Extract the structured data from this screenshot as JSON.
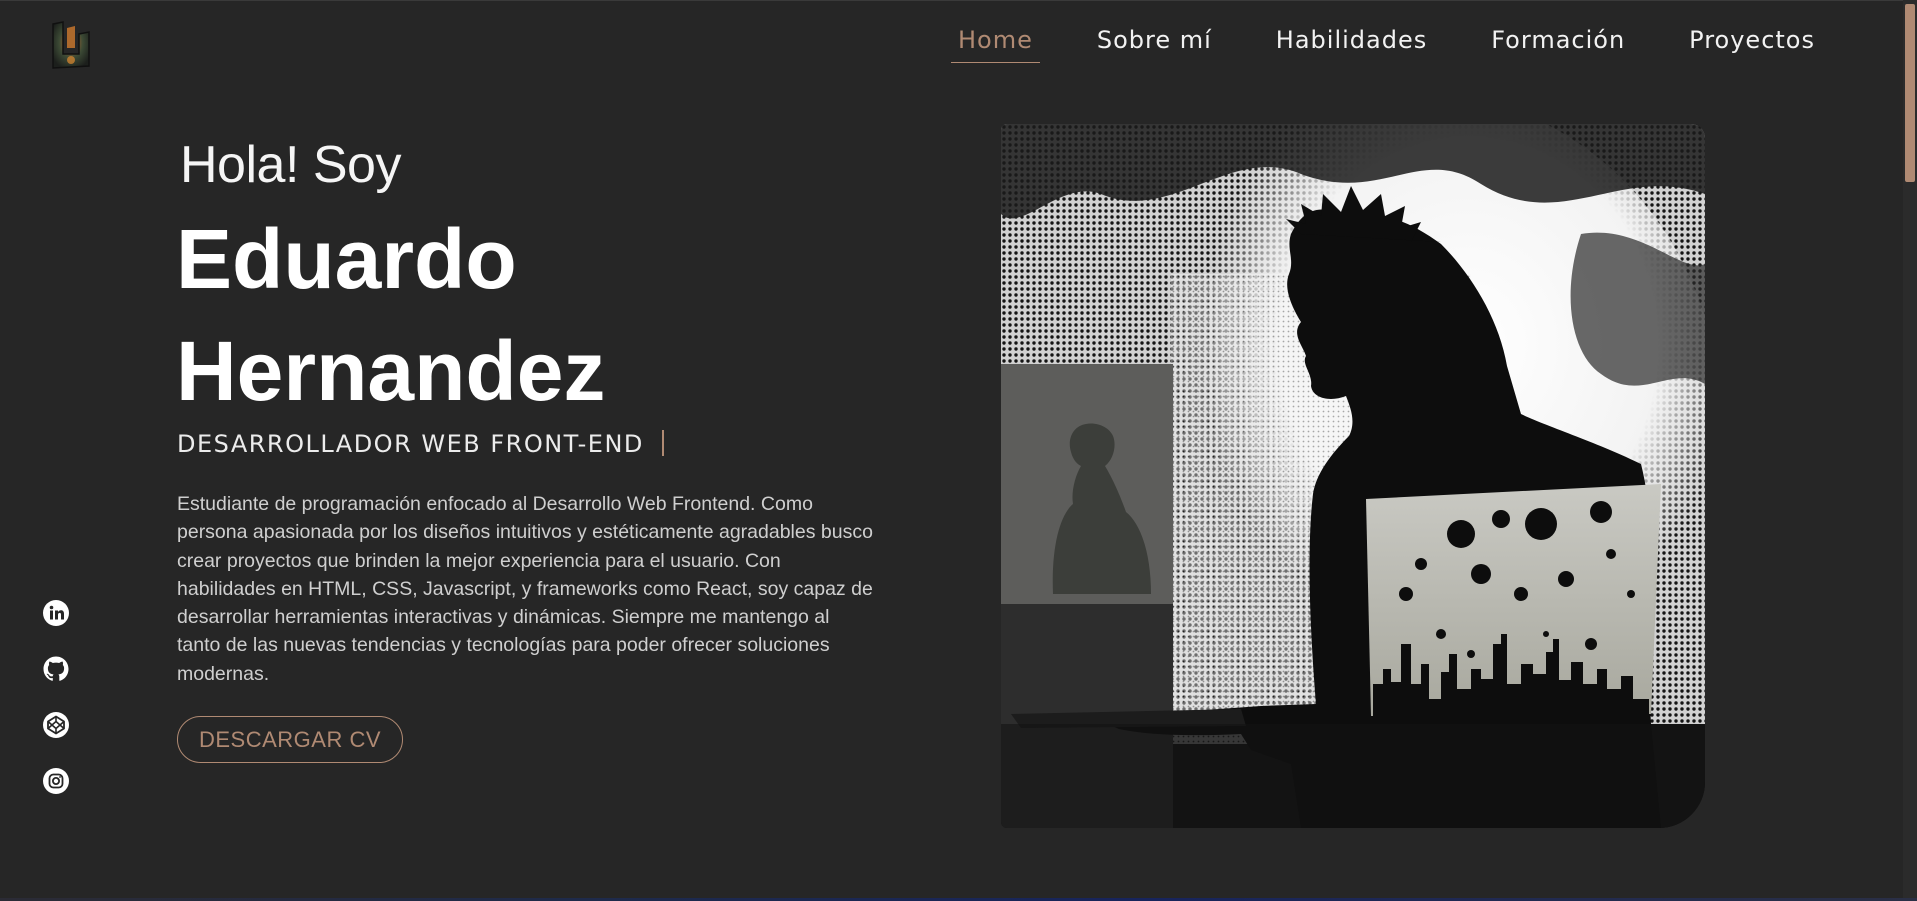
{
  "nav": {
    "items": [
      {
        "label": "Home",
        "active": true
      },
      {
        "label": "Sobre mí",
        "active": false
      },
      {
        "label": "Habilidades",
        "active": false
      },
      {
        "label": "Formación",
        "active": false
      },
      {
        "label": "Proyectos",
        "active": false
      }
    ]
  },
  "hero": {
    "greeting": "Hola! Soy",
    "name_line1": "Eduardo",
    "name_line2": "Hernandez",
    "role": "DESARROLLADOR WEB FRONT-END",
    "bio": "Estudiante de programación enfocado al Desarrollo Web Frontend. Como persona apasionada por los diseños intuitivos y estéticamente agradables busco crear proyectos que brinden la mejor experiencia para el usuario. Con habilidades en HTML, CSS, Javascript, y frameworks como React, soy capaz de desarrollar herramientas interactivas y dinámicas. Siempre me mantengo al tanto de las nuevas tendencias y tecnologías para poder ofrecer soluciones modernas.",
    "cv_button": "DESCARGAR CV"
  },
  "socials": [
    {
      "icon": "linkedin-icon"
    },
    {
      "icon": "github-icon"
    },
    {
      "icon": "codepen-icon"
    },
    {
      "icon": "instagram-icon"
    }
  ],
  "colors": {
    "background": "#262626",
    "accent": "#b08a73",
    "text": "#ffffff",
    "muted_text": "#cfcfcf"
  }
}
